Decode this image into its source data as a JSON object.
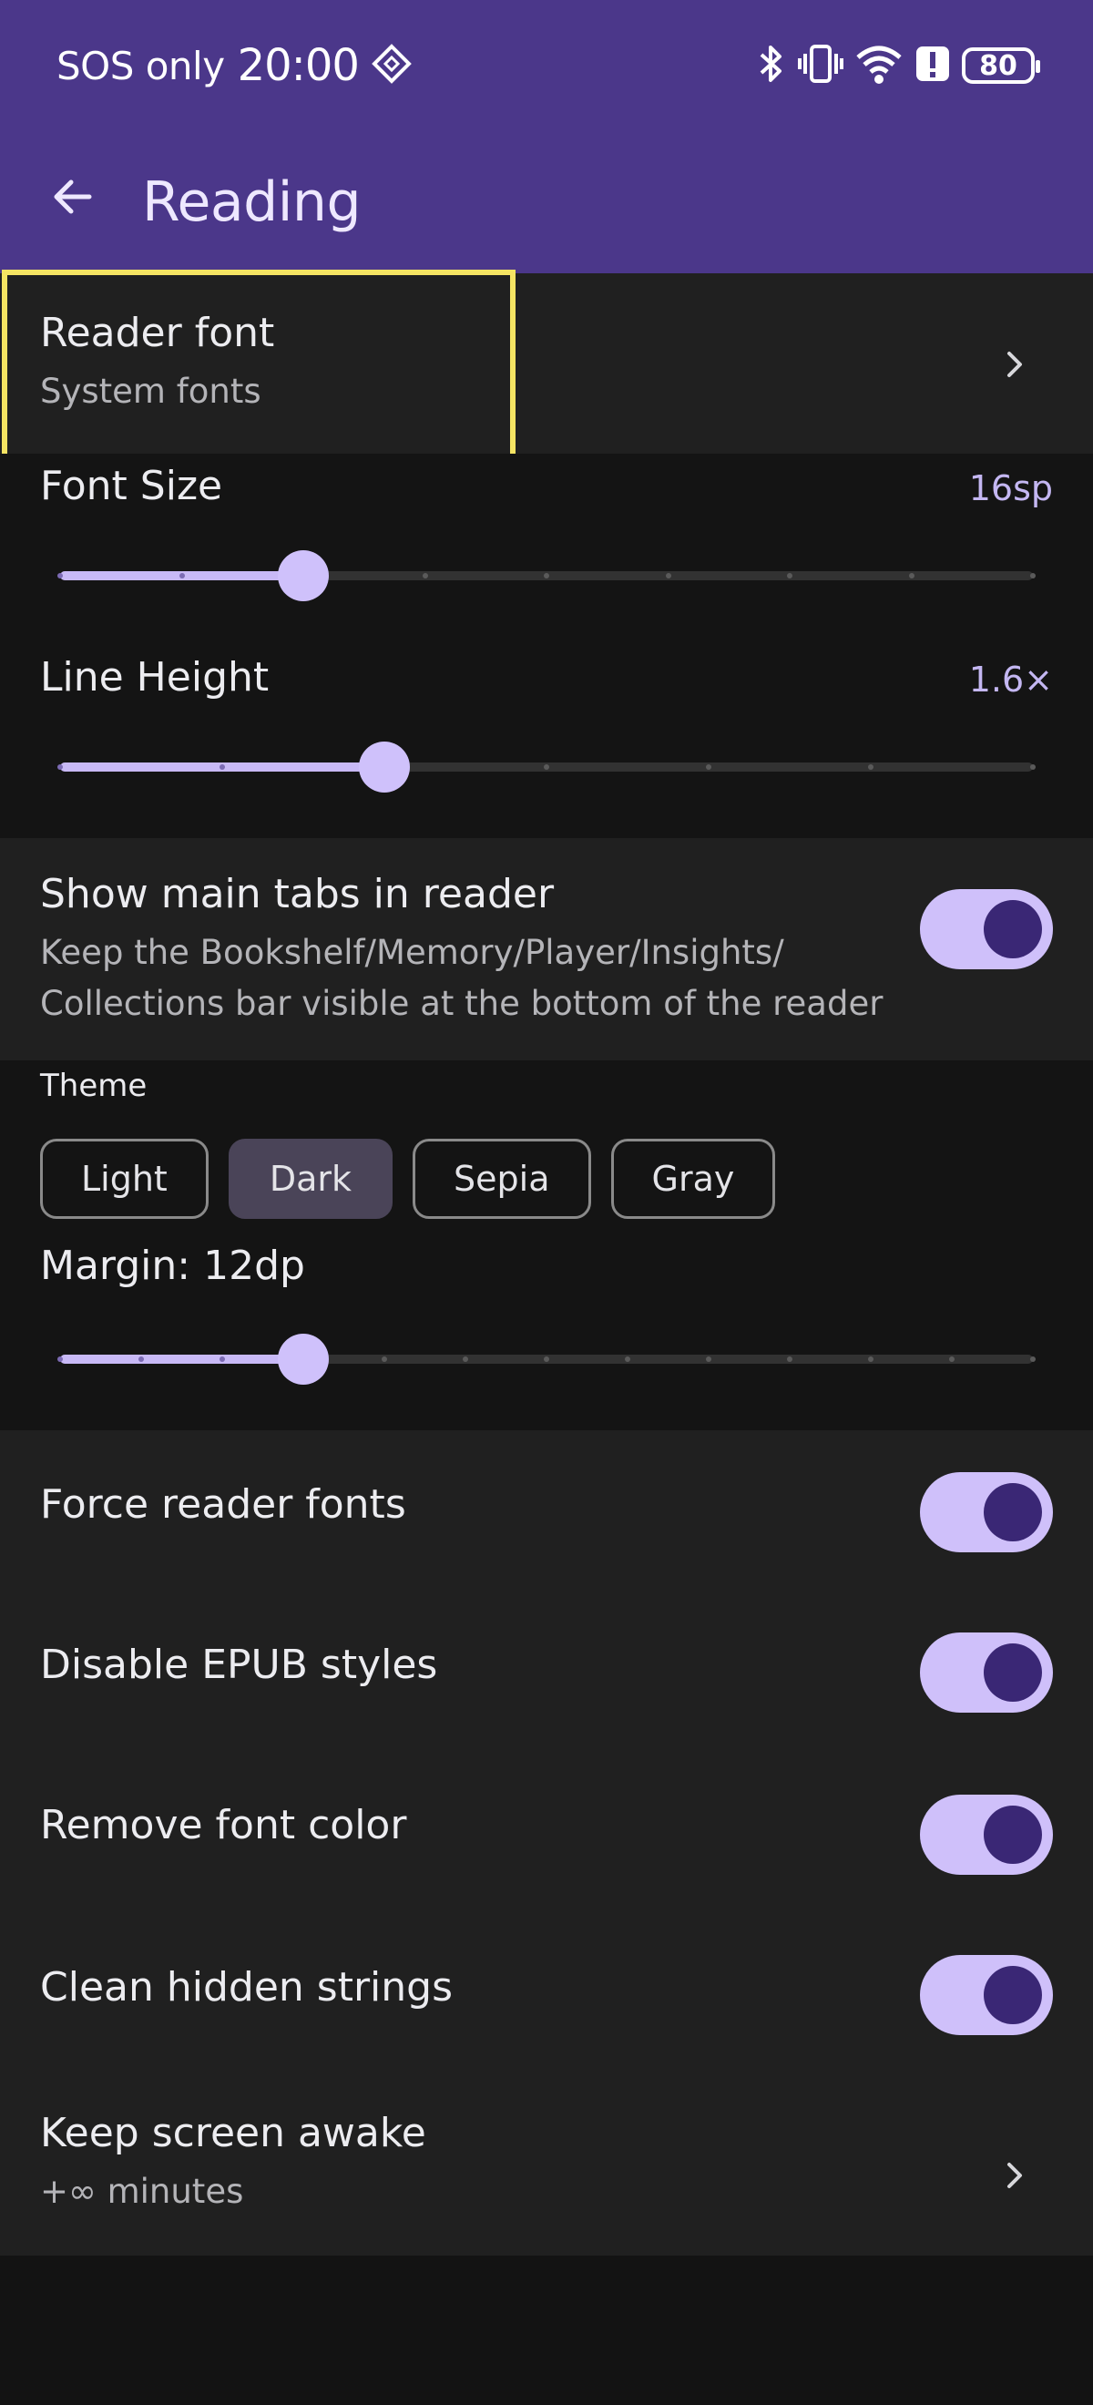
{
  "status_bar": {
    "carrier": "SOS only",
    "time": "20:00",
    "battery": "80"
  },
  "app_bar": {
    "title": "Reading"
  },
  "reader_font": {
    "title": "Reader font",
    "subtitle": "System fonts"
  },
  "font_size": {
    "label": "Font Size",
    "value": "16sp",
    "level": 0.25,
    "steps": 8
  },
  "line_height": {
    "label": "Line Height",
    "value": "1.6×",
    "level": 0.333,
    "steps": 6
  },
  "show_main_tabs": {
    "title": "Show main tabs in reader",
    "subtitle_line1": "Keep the Bookshelf/Memory/Player/Insights/",
    "subtitle_line2": "Collections bar visible at the bottom of the reader",
    "enabled": true
  },
  "theme": {
    "label": "Theme",
    "options": [
      "Light",
      "Dark",
      "Sepia",
      "Gray"
    ],
    "selected": "Dark"
  },
  "margin": {
    "label": "Margin: 12dp",
    "level": 0.25,
    "steps": 12
  },
  "toggles": [
    {
      "label": "Force reader fonts",
      "enabled": true
    },
    {
      "label": "Disable EPUB styles",
      "enabled": true
    },
    {
      "label": "Remove font color",
      "enabled": true
    },
    {
      "label": "Clean hidden strings",
      "enabled": true
    }
  ],
  "keep_screen_awake": {
    "title": "Keep screen awake",
    "subtitle": "+∞ minutes"
  },
  "colors": {
    "app_bar": "#4b378a",
    "accent": "#cfc1fb",
    "highlight": "#f5e463"
  },
  "icons": [
    "back-arrow-icon",
    "chevron-right-icon",
    "bluetooth-icon",
    "vibrate-icon",
    "wifi-icon",
    "alert-icon",
    "battery-icon",
    "diamond-icon"
  ]
}
